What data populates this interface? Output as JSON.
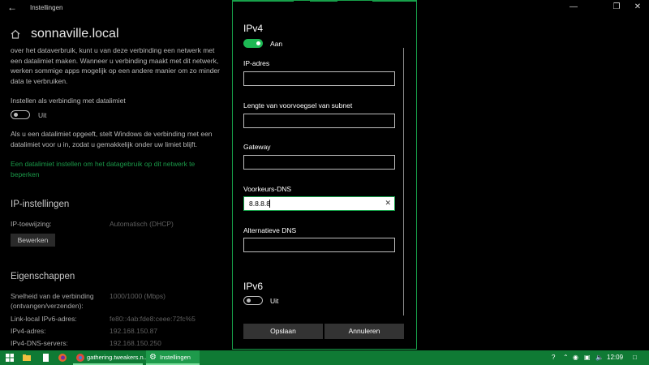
{
  "window": {
    "app_title": "Instellingen",
    "page_title": "sonnaville.local"
  },
  "left": {
    "intro": "over het dataverbruik, kunt u van deze verbinding een netwerk met een datalimiet maken. Wanneer u verbinding maakt met dit netwerk, werken sommige apps mogelijk op een andere manier om zo minder data te verbruiken.",
    "metered_label": "Instellen als verbinding met datalimiet",
    "metered_state": "Uit",
    "limit_text": "Als u een datalimiet opgeeft, stelt Windows de verbinding met een datalimiet voor u in, zodat u gemakkelijk onder uw limiet blijft.",
    "limit_link": "Een datalimiet instellen om het datagebruik op dit netwerk te beperken",
    "ip_heading": "IP-instellingen",
    "ip_assign_label": "IP-toewijzing:",
    "ip_assign_value": "Automatisch (DHCP)",
    "edit_button": "Bewerken",
    "props_heading": "Eigenschappen",
    "props": [
      {
        "label": "Snelheid van de verbinding\n(ontvangen/verzenden):",
        "value": "1000/1000 (Mbps)"
      },
      {
        "label": "Link-local IPv6-adres:",
        "value": "fe80::4ab:fde8:ceee:72fc%5"
      },
      {
        "label": "IPv4-adres:",
        "value": "192.168.150.87"
      },
      {
        "label": "IPv4-DNS-servers:",
        "value": "192.168.150.250"
      }
    ]
  },
  "dialog": {
    "ipv4_heading": "IPv4",
    "ipv4_state": "Aan",
    "fields": [
      {
        "label": "IP-adres",
        "value": ""
      },
      {
        "label": "Lengte van voorvoegsel van subnet",
        "value": ""
      },
      {
        "label": "Gateway",
        "value": ""
      },
      {
        "label": "Voorkeurs-DNS",
        "value": "8.8.8.8"
      },
      {
        "label": "Alternatieve DNS",
        "value": ""
      }
    ],
    "ipv6_heading": "IPv6",
    "ipv6_state": "Uit",
    "save_button": "Opslaan",
    "cancel_button": "Annuleren"
  },
  "taskbar": {
    "browser_task": "gathering.tweakers.n...",
    "settings_task": "Instellingen",
    "clock": "12:09",
    "accent": "#0f7a34"
  }
}
